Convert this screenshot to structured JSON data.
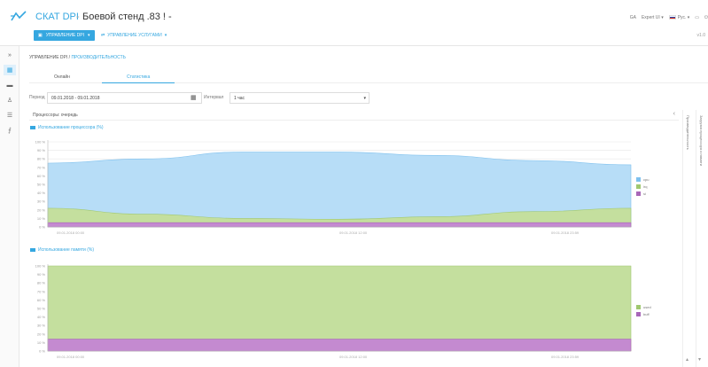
{
  "header": {
    "brand": "СКАТ DPI",
    "separator": "-",
    "device": "Боевой стенд .83 ! -",
    "right": {
      "user": "GA",
      "user_menu": "Expert UI",
      "language": "Рус.",
      "icons": [
        "window-icon",
        "power-icon"
      ]
    },
    "primary_tab": "УПРАВЛЕНИЕ DPI",
    "secondary_tab": "УПРАВЛЕНИЕ УСЛУГАМИ",
    "version": "v1.0"
  },
  "sidebar": {
    "items": [
      {
        "icon": "expand-icon",
        "glyph": "»",
        "active": false
      },
      {
        "icon": "dashboard-icon",
        "glyph": "▦",
        "active": true
      },
      {
        "icon": "server-icon",
        "glyph": "▬",
        "active": false
      },
      {
        "icon": "users-icon",
        "glyph": "♙",
        "active": false
      },
      {
        "icon": "list-icon",
        "glyph": "☰",
        "active": false
      },
      {
        "icon": "chart-icon",
        "glyph": "⨍",
        "active": false
      }
    ]
  },
  "breadcrumb": {
    "root": "УПРАВЛЕНИЕ DPI",
    "sep": " / ",
    "current": "ПРОИЗВОДИТЕЛЬНОСТЬ"
  },
  "view_tabs": [
    "Онлайн",
    "Статистика"
  ],
  "filters": {
    "period_label": "Период",
    "period_value": "09.01.2018 - 09.01.2018",
    "interval_label": "Интервал",
    "interval_value": "1 час"
  },
  "panel": {
    "title": "Процессоры: очередь",
    "right_tabs": [
      "Производительность",
      "Загрузка процессора и памяти"
    ]
  },
  "chart_data": [
    {
      "type": "area",
      "title": "Использование процессора (%)",
      "x": [
        "09.01.2018 00:00",
        "09.01.2018 12:00",
        "09.01.2018 23:59"
      ],
      "ylim": [
        0,
        100
      ],
      "yticks": [
        "100 %",
        "90 %",
        "80 %",
        "70 %",
        "60 %",
        "50 %",
        "40 %",
        "30 %",
        "20 %",
        "10 %",
        "0 %"
      ],
      "series": [
        {
          "name": "cpu",
          "color": "#b7ddf7",
          "stroke": "#7fc1ee",
          "values": [
            75,
            80,
            88,
            88,
            84,
            78,
            73
          ]
        },
        {
          "name": "irq",
          "color": "#c4df9e",
          "stroke": "#a0c870",
          "values": [
            22,
            15,
            10,
            9,
            12,
            18,
            22
          ]
        },
        {
          "name": "si",
          "color": "#c48ad0",
          "stroke": "#a867b8",
          "values": [
            5,
            5,
            5,
            5,
            5,
            5,
            5
          ]
        }
      ],
      "legend": "right",
      "grid": true
    },
    {
      "type": "area",
      "title": "Использование памяти (%)",
      "x": [
        "09.01.2018 00:00",
        "09.01.2018 12:00",
        "09.01.2018 23:59"
      ],
      "ylim": [
        0,
        100
      ],
      "yticks": [
        "100 %",
        "90 %",
        "80 %",
        "70 %",
        "60 %",
        "50 %",
        "40 %",
        "30 %",
        "20 %",
        "10 %",
        "0 %"
      ],
      "series": [
        {
          "name": "used",
          "color": "#c4df9e",
          "stroke": "#a0c870",
          "values": [
            100,
            100,
            100,
            100,
            100,
            100,
            100
          ]
        },
        {
          "name": "buff",
          "color": "#c48ad0",
          "stroke": "#a867b8",
          "values": [
            14,
            14,
            14,
            14,
            14,
            14,
            14
          ]
        }
      ],
      "legend": "right",
      "grid": true
    }
  ]
}
